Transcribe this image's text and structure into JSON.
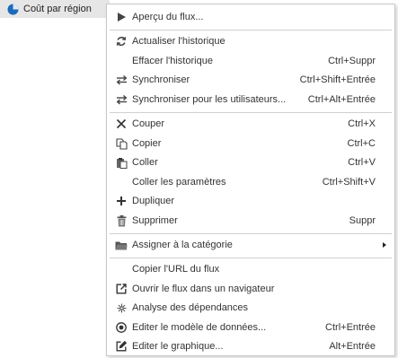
{
  "tree": {
    "item_label": "Coût par région",
    "icon": "pie-chart-icon",
    "icon_color": "#1a6ab8"
  },
  "menu": {
    "items": [
      {
        "label": "Aperçu du flux...",
        "shortcut": "",
        "icon": "play-icon"
      },
      {
        "label": "Actualiser l'historique",
        "shortcut": "",
        "icon": "refresh-icon"
      },
      {
        "label": "Effacer l'historique",
        "shortcut": "Ctrl+Suppr",
        "icon": ""
      },
      {
        "label": "Synchroniser",
        "shortcut": "Ctrl+Shift+Entrée",
        "icon": "sync-arrows-icon"
      },
      {
        "label": "Synchroniser pour les utilisateurs...",
        "shortcut": "Ctrl+Alt+Entrée",
        "icon": "sync-arrows-icon"
      },
      {
        "label": "Couper",
        "shortcut": "Ctrl+X",
        "icon": "cut-icon"
      },
      {
        "label": "Copier",
        "shortcut": "Ctrl+C",
        "icon": "copy-icon"
      },
      {
        "label": "Coller",
        "shortcut": "Ctrl+V",
        "icon": "paste-icon"
      },
      {
        "label": "Coller les paramètres",
        "shortcut": "Ctrl+Shift+V",
        "icon": ""
      },
      {
        "label": "Dupliquer",
        "shortcut": "",
        "icon": "plus-icon"
      },
      {
        "label": "Supprimer",
        "shortcut": "Suppr",
        "icon": "trash-icon"
      },
      {
        "label": "Assigner à la catégorie",
        "shortcut": "",
        "icon": "folder-icon"
      },
      {
        "label": "Copier l'URL du flux",
        "shortcut": "",
        "icon": ""
      },
      {
        "label": "Ouvrir le flux dans un navigateur",
        "shortcut": "",
        "icon": "external-link-icon"
      },
      {
        "label": "Analyse des dépendances",
        "shortcut": "",
        "icon": "dependency-icon"
      },
      {
        "label": "Editer le modèle de données...",
        "shortcut": "Ctrl+Entrée",
        "icon": "data-model-icon"
      },
      {
        "label": "Editer le graphique...",
        "shortcut": "Alt+Entrée",
        "icon": "edit-chart-icon"
      }
    ]
  }
}
